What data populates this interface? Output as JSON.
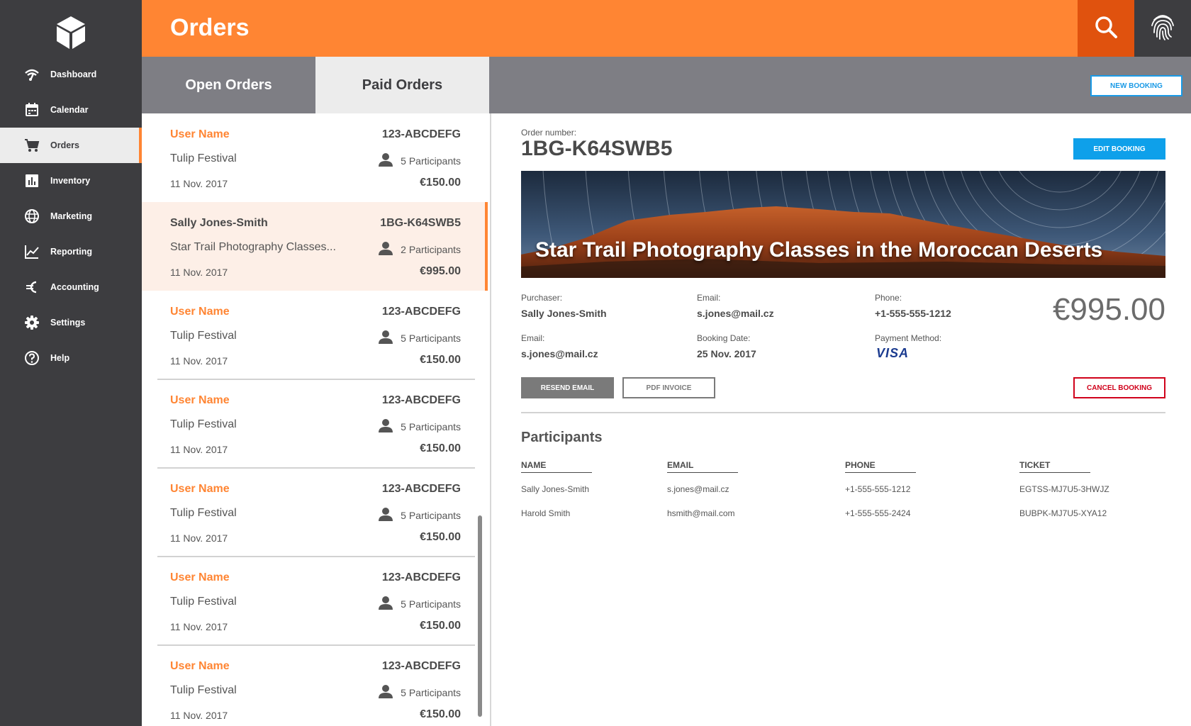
{
  "sidebar": {
    "items": [
      {
        "label": "Dashboard",
        "icon": "wifi-icon"
      },
      {
        "label": "Calendar",
        "icon": "calendar-icon"
      },
      {
        "label": "Orders",
        "icon": "cart-icon"
      },
      {
        "label": "Inventory",
        "icon": "bar-chart-icon"
      },
      {
        "label": "Marketing",
        "icon": "globe-icon"
      },
      {
        "label": "Reporting",
        "icon": "line-chart-icon"
      },
      {
        "label": "Accounting",
        "icon": "euro-icon"
      },
      {
        "label": "Settings",
        "icon": "gear-icon"
      },
      {
        "label": "Help",
        "icon": "help-icon"
      }
    ],
    "active": "Orders"
  },
  "header": {
    "title": "Orders"
  },
  "tabs": {
    "open": "Open Orders",
    "paid": "Paid Orders",
    "active": "Paid Orders"
  },
  "toolbar": {
    "new_booking": "NEW BOOKING"
  },
  "orders": [
    {
      "name": "User Name",
      "code": "123-ABCDEFG",
      "event": "Tulip Festival",
      "participants": "5 Participants",
      "date": "11 Nov. 2017",
      "price": "€150.00"
    },
    {
      "name": "Sally Jones-Smith",
      "code": "1BG-K64SWB5",
      "event": "Star Trail Photography Classes...",
      "participants": "2 Participants",
      "date": "11 Nov. 2017",
      "price": "€995.00"
    },
    {
      "name": "User Name",
      "code": "123-ABCDEFG",
      "event": "Tulip Festival",
      "participants": "5 Participants",
      "date": "11 Nov. 2017",
      "price": "€150.00"
    },
    {
      "name": "User Name",
      "code": "123-ABCDEFG",
      "event": "Tulip Festival",
      "participants": "5 Participants",
      "date": "11 Nov. 2017",
      "price": "€150.00"
    },
    {
      "name": "User Name",
      "code": "123-ABCDEFG",
      "event": "Tulip Festival",
      "participants": "5 Participants",
      "date": "11 Nov. 2017",
      "price": "€150.00"
    },
    {
      "name": "User Name",
      "code": "123-ABCDEFG",
      "event": "Tulip Festival",
      "participants": "5 Participants",
      "date": "11 Nov. 2017",
      "price": "€150.00"
    },
    {
      "name": "User Name",
      "code": "123-ABCDEFG",
      "event": "Tulip Festival",
      "participants": "5 Participants",
      "date": "11 Nov. 2017",
      "price": "€150.00"
    }
  ],
  "detail": {
    "order_number_label": "Order number:",
    "order_number": "1BG-K64SWB5",
    "edit_booking": "EDIT BOOKING",
    "banner_title": "Star Trail Photography Classes in the Moroccan Deserts",
    "purchaser_label": "Purchaser:",
    "purchaser": "Sally Jones-Smith",
    "email_label": "Email:",
    "email": "s.jones@mail.cz",
    "phone_label": "Phone:",
    "phone": "+1-555-555-1212",
    "email2_label": "Email:",
    "email2": "s.jones@mail.cz",
    "booking_date_label": "Booking Date:",
    "booking_date": "25 Nov. 2017",
    "payment_method_label": "Payment Method:",
    "payment_method": "VISA",
    "price": "€995.00",
    "resend_email": "RESEND EMAIL",
    "pdf_invoice": "PDF INVOICE",
    "cancel_booking": "CANCEL BOOKING"
  },
  "participants": {
    "heading": "Participants",
    "columns": [
      "NAME",
      "EMAIL",
      "PHONE",
      "TICKET"
    ],
    "rows": [
      [
        "Sally Jones-Smith",
        "s.jones@mail.cz",
        "+1-555-555-1212",
        "EGTSS-MJ7U5-3HWJZ"
      ],
      [
        "Harold Smith",
        "hsmith@mail.com",
        "+1-555-555-2424",
        "BUBPK-MJ7U5-XYA12"
      ]
    ]
  },
  "colors": {
    "accent": "#ff8533",
    "search_bg": "#e0520e",
    "sidebar_bg": "#3d3d40",
    "tabs_bg": "#7e7e84",
    "primary_blue": "#0ea0ea",
    "danger": "#d0021b",
    "selected_row_bg": "#fdefe7"
  }
}
